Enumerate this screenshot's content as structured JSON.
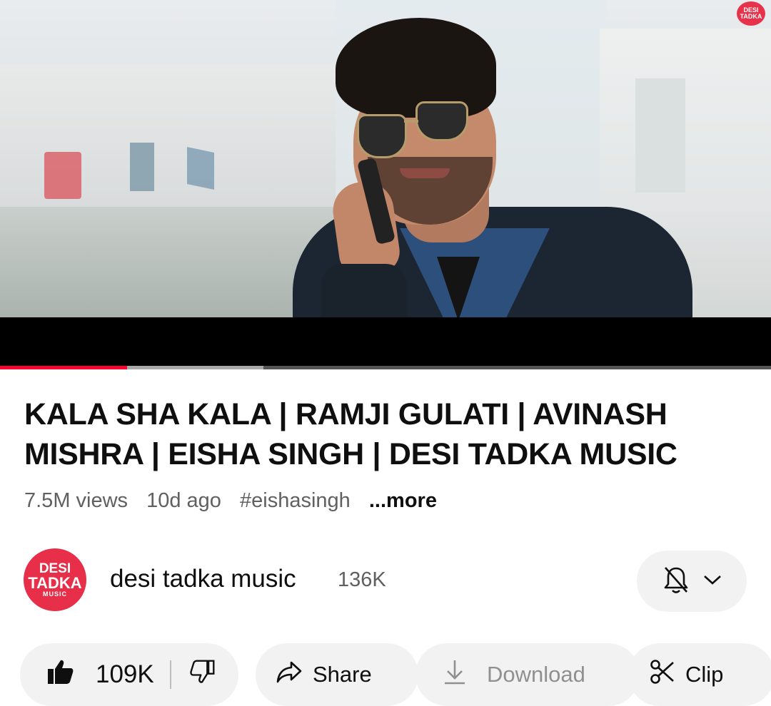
{
  "video": {
    "channel_watermark": "DESI TADKA MUSIC",
    "progress": {
      "played_fraction": 0.165,
      "buffered_fraction": 0.342
    }
  },
  "details": {
    "title": "KALA SHA KALA | RAMJI GULATI | AVINASH MISHRA | EISHA SINGH | DESI TADKA MUSIC",
    "views": "7.5M views",
    "age": "10d ago",
    "hashtag": "#eishasingh",
    "more_label": "...more"
  },
  "channel": {
    "avatar_text": {
      "line1": "DESI",
      "line2": "TADKA",
      "line3": "MUSIC"
    },
    "name": "desi tadka music",
    "subscribers": "136K",
    "notification_icon": "bell-off-icon"
  },
  "actions": {
    "like_count": "109K",
    "share_label": "Share",
    "download_label": "Download",
    "clip_label": "Clip"
  },
  "colors": {
    "accent": "#ff0033",
    "brand": "#e72f4a",
    "chip_bg": "#f2f2f2"
  }
}
